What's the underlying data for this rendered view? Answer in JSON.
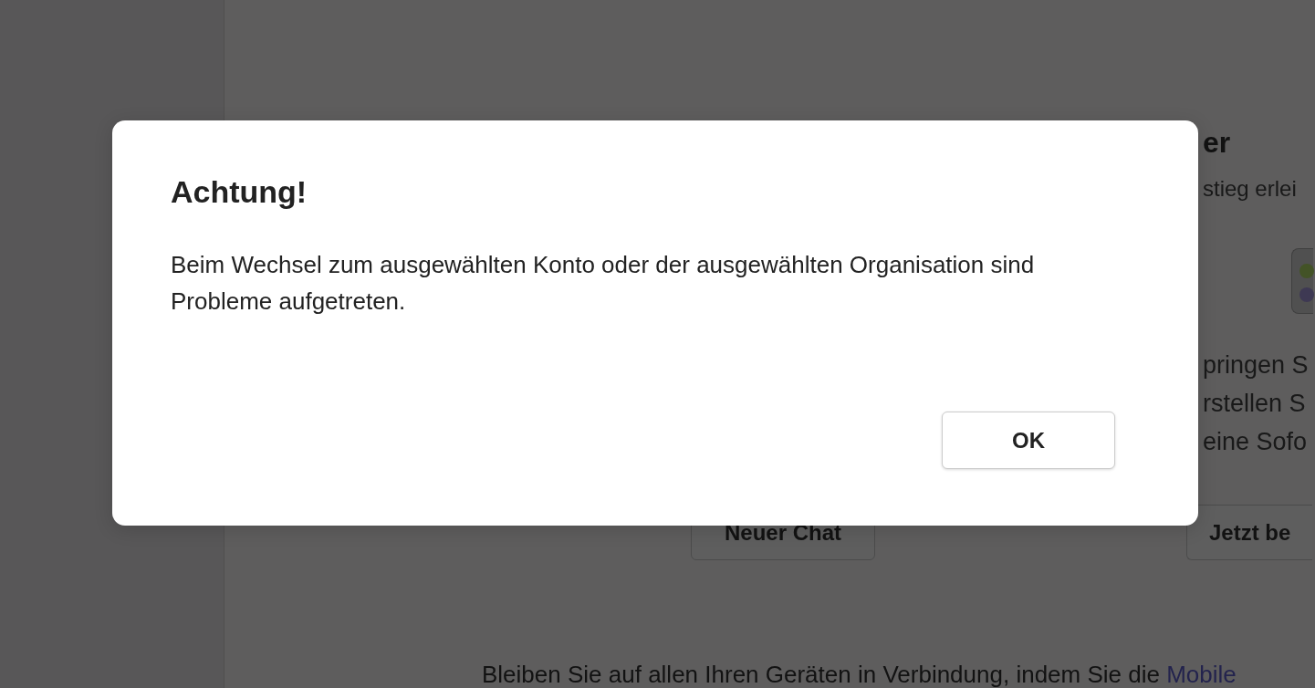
{
  "background": {
    "heading": "er",
    "subtitle": "stieg erlei",
    "lines": [
      "pringen S",
      "rstellen S",
      "eine Sofo"
    ],
    "buttons": [
      {
        "label": "Neuer Chat"
      },
      {
        "label": "Jetzt be"
      }
    ],
    "footer": {
      "text": "Bleiben Sie auf allen Ihren Geräten in Verbindung, indem Sie die",
      "link": "Mobile"
    }
  },
  "dialog": {
    "title": "Achtung!",
    "message": "Beim Wechsel zum ausgewählten Konto oder der ausgewählten Organisation sind Probleme aufgetreten.",
    "buttons": [
      "OK"
    ]
  }
}
